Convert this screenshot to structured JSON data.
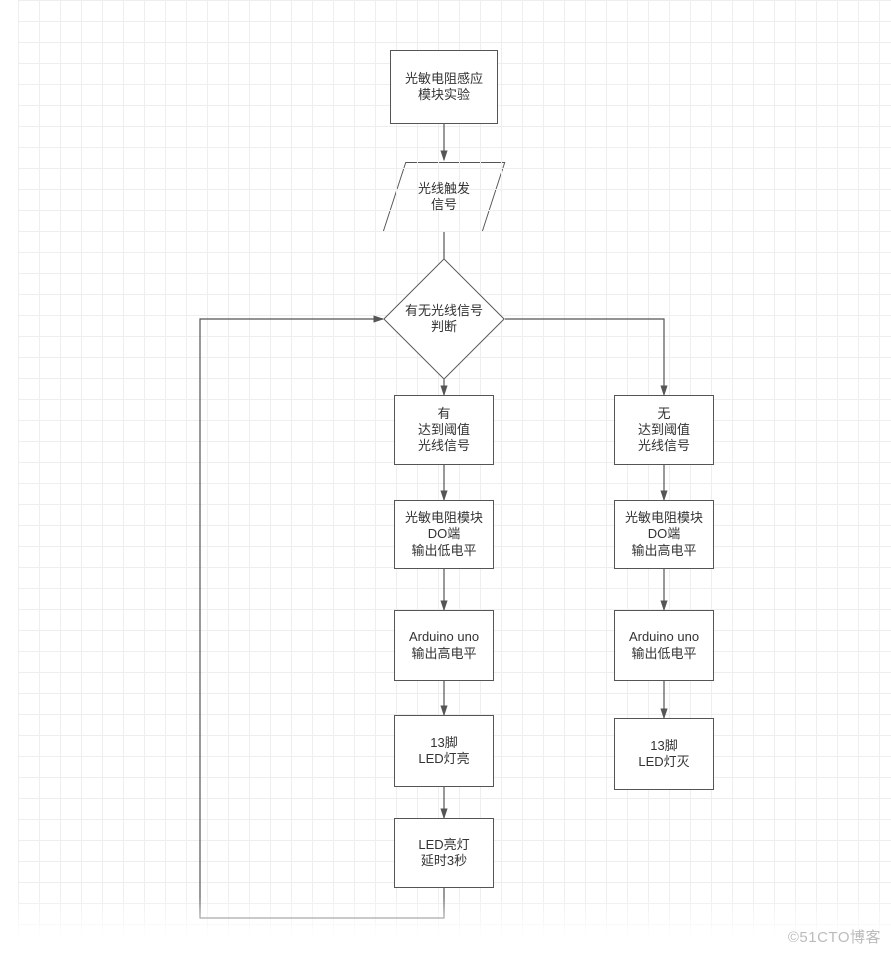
{
  "chart_data": {
    "type": "flowchart",
    "title": "光敏电阻感应模块实验",
    "nodes": [
      {
        "id": "start",
        "type": "process",
        "text": [
          "光敏电阻感应",
          "模块实验"
        ]
      },
      {
        "id": "trigger",
        "type": "io",
        "text": [
          "光线触发",
          "信号"
        ]
      },
      {
        "id": "decision",
        "type": "decision",
        "text": [
          "有无光线信号",
          "判断"
        ]
      },
      {
        "id": "yes1",
        "type": "process",
        "text": [
          "有",
          "达到阈值",
          "光线信号"
        ]
      },
      {
        "id": "yes2",
        "type": "process",
        "text": [
          "光敏电阻模块",
          "DO端",
          "输出低电平"
        ]
      },
      {
        "id": "yes3",
        "type": "process",
        "text": [
          "Arduino uno",
          "输出高电平"
        ]
      },
      {
        "id": "yes4",
        "type": "process",
        "text": [
          "13脚",
          "LED灯亮"
        ]
      },
      {
        "id": "yes5",
        "type": "process",
        "text": [
          "LED亮灯",
          "延时3秒"
        ]
      },
      {
        "id": "no1",
        "type": "process",
        "text": [
          "无",
          "达到阈值",
          "光线信号"
        ]
      },
      {
        "id": "no2",
        "type": "process",
        "text": [
          "光敏电阻模块",
          "DO端",
          "输出高电平"
        ]
      },
      {
        "id": "no3",
        "type": "process",
        "text": [
          "Arduino uno",
          "输出低电平"
        ]
      },
      {
        "id": "no4",
        "type": "process",
        "text": [
          "13脚",
          "LED灯灭"
        ]
      }
    ],
    "edges": [
      {
        "from": "start",
        "to": "trigger"
      },
      {
        "from": "trigger",
        "to": "decision"
      },
      {
        "from": "decision",
        "to": "yes1",
        "label": ""
      },
      {
        "from": "decision",
        "to": "no1",
        "label": ""
      },
      {
        "from": "yes1",
        "to": "yes2"
      },
      {
        "from": "yes2",
        "to": "yes3"
      },
      {
        "from": "yes3",
        "to": "yes4"
      },
      {
        "from": "yes4",
        "to": "yes5"
      },
      {
        "from": "yes5",
        "to": "decision",
        "label": "",
        "note": "loop back"
      },
      {
        "from": "no1",
        "to": "no2"
      },
      {
        "from": "no2",
        "to": "no3"
      },
      {
        "from": "no3",
        "to": "no4"
      }
    ]
  },
  "nodes": {
    "start_l1": "光敏电阻感应",
    "start_l2": "模块实验",
    "trigger_l1": "光线触发",
    "trigger_l2": "信号",
    "decision_l1": "有无光线信号",
    "decision_l2": "判断",
    "yes1_l1": "有",
    "yes1_l2": "达到阈值",
    "yes1_l3": "光线信号",
    "yes2_l1": "光敏电阻模块",
    "yes2_l2": "DO端",
    "yes2_l3": "输出低电平",
    "yes3_l1": "Arduino uno",
    "yes3_l2": "输出高电平",
    "yes4_l1": "13脚",
    "yes4_l2": "LED灯亮",
    "yes5_l1": "LED亮灯",
    "yes5_l2": "延时3秒",
    "no1_l1": "无",
    "no1_l2": "达到阈值",
    "no1_l3": "光线信号",
    "no2_l1": "光敏电阻模块",
    "no2_l2": "DO端",
    "no2_l3": "输出高电平",
    "no3_l1": "Arduino uno",
    "no3_l2": "输出低电平",
    "no4_l1": "13脚",
    "no4_l2": "LED灯灭"
  },
  "watermark": "©51CTO博客"
}
